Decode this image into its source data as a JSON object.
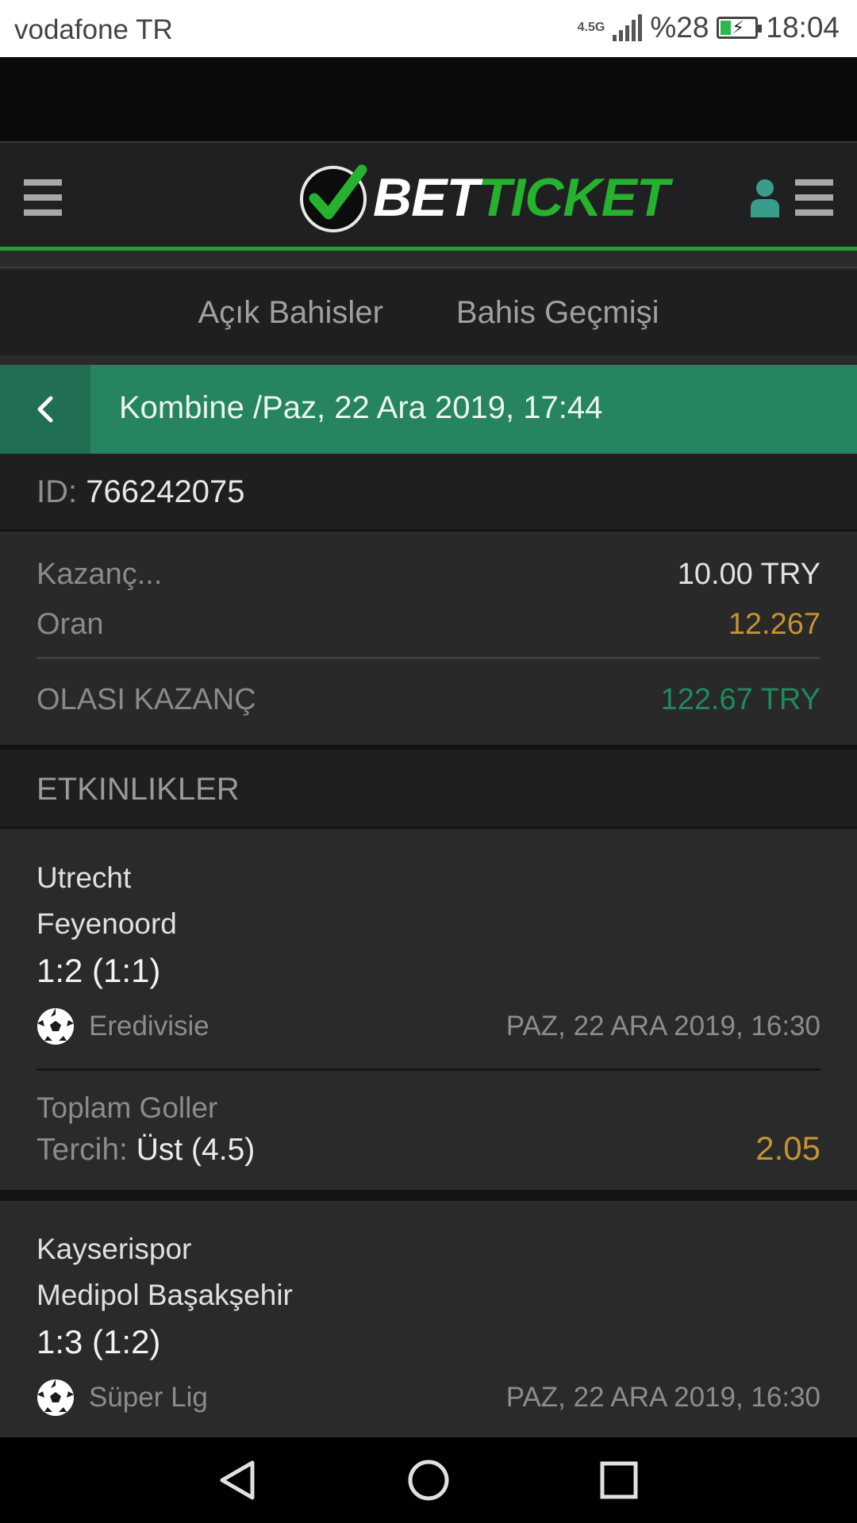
{
  "status_bar": {
    "carrier": "vodafone TR",
    "network": "4.5G",
    "battery": "%28",
    "time": "18:04"
  },
  "header": {
    "logo_bet": "BET",
    "logo_ticket": "TICKET",
    "brand_color": "#26b22f"
  },
  "tabs": [
    {
      "label": "Açık Bahisler"
    },
    {
      "label": "Bahis Geçmişi"
    }
  ],
  "bet": {
    "title": "Kombine /Paz, 22 Ara 2019, 17:44",
    "id_label": "ID:",
    "id_value": "766242075",
    "stake_label": "Kazanç...",
    "stake_value": "10.00 TRY",
    "odds_label": "Oran",
    "odds_value": "12.267",
    "potential_label": "OLASI KAZANÇ",
    "potential_value": "122.67 TRY"
  },
  "events_section": {
    "title": "ETKINLIKLER"
  },
  "events": [
    {
      "home": "Utrecht",
      "away": "Feyenoord",
      "score": "1:2 (1:1)",
      "league": "Eredivisie",
      "date": "PAZ, 22 ARA 2019, 16:30",
      "market": "Toplam Goller",
      "pref_label": "Tercih:",
      "pref_value": "Üst (4.5)",
      "odd": "2.05"
    },
    {
      "home": "Kayserispor",
      "away": "Medipol Başakşehir",
      "score": "1:3 (1:2)",
      "league": "Süper Lig",
      "date": "PAZ, 22 ARA 2019, 16:30"
    }
  ],
  "colors": {
    "title_bar": "#268560",
    "odds": "#c69330",
    "potential": "#1f8a5e"
  }
}
